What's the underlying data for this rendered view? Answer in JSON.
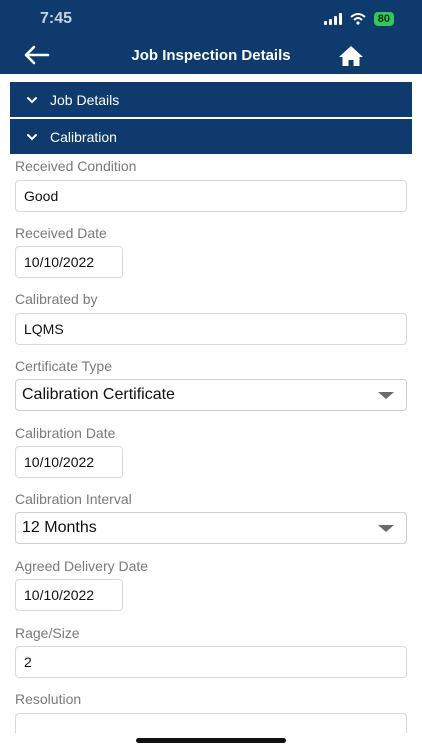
{
  "status_bar": {
    "time": "7:45",
    "battery": "80"
  },
  "nav": {
    "title": "Job Inspection Details"
  },
  "sections": {
    "job_details": "Job Details",
    "calibration": "Calibration"
  },
  "fields": {
    "received_condition": {
      "label": "Received Condition",
      "value": "Good"
    },
    "received_date": {
      "label": "Received Date",
      "value": "10/10/2022"
    },
    "calibrated_by": {
      "label": "Calibrated by",
      "value": "LQMS"
    },
    "certificate_type": {
      "label": "Certificate Type",
      "value": "Calibration Certificate"
    },
    "calibration_date": {
      "label": "Calibration Date",
      "value": "10/10/2022"
    },
    "calibration_interval": {
      "label": "Calibration Interval",
      "value": "12 Months"
    },
    "agreed_delivery_date": {
      "label": "Agreed Delivery Date",
      "value": "10/10/2022"
    },
    "rage_size": {
      "label": "Rage/Size",
      "value": "2"
    },
    "resolution": {
      "label": "Resolution",
      "value": ""
    }
  },
  "colors": {
    "header_bg": "#0e3a6e",
    "battery": "#34c759"
  },
  "icons": [
    "back-arrow-icon",
    "home-icon",
    "chevron-down-icon",
    "dropdown-caret-icon",
    "signal-icon",
    "wifi-icon",
    "battery-icon"
  ]
}
